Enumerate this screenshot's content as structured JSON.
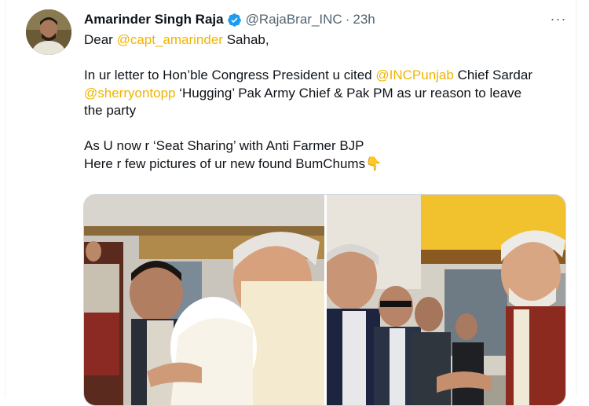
{
  "tweet": {
    "display_name": "Amarinder Singh Raja",
    "handle": "@RajaBrar_INC",
    "separator": "·",
    "time": "23h",
    "more_label": "···",
    "greeting_prefix": "Dear ",
    "greeting_mention": "@capt_amarinder",
    "greeting_suffix": " Sahab,",
    "p1_a": "In ur letter to Hon’ble Congress President u cited ",
    "p1_mention": "@INCPunjab",
    "p1_b": " Chief Sardar",
    "p1_mention2": "@sherryontopp",
    "p1_c": " ‘Hugging’ Pak Army Chief & Pak PM as ur reason to leave",
    "p1_d": "the party",
    "p2_line1": "As U now r ‘Seat Sharing’ with Anti Farmer BJP",
    "p2_line2": "Here r few pictures of ur new found BumChums",
    "p2_emoji": "👇"
  },
  "colors": {
    "mention": "#f0b400",
    "verified": "#1d9bf0",
    "secondary_text": "#536471",
    "border": "#cfd9de"
  },
  "icons": {
    "verified": "verified-badge-icon",
    "more": "more-options-icon"
  }
}
